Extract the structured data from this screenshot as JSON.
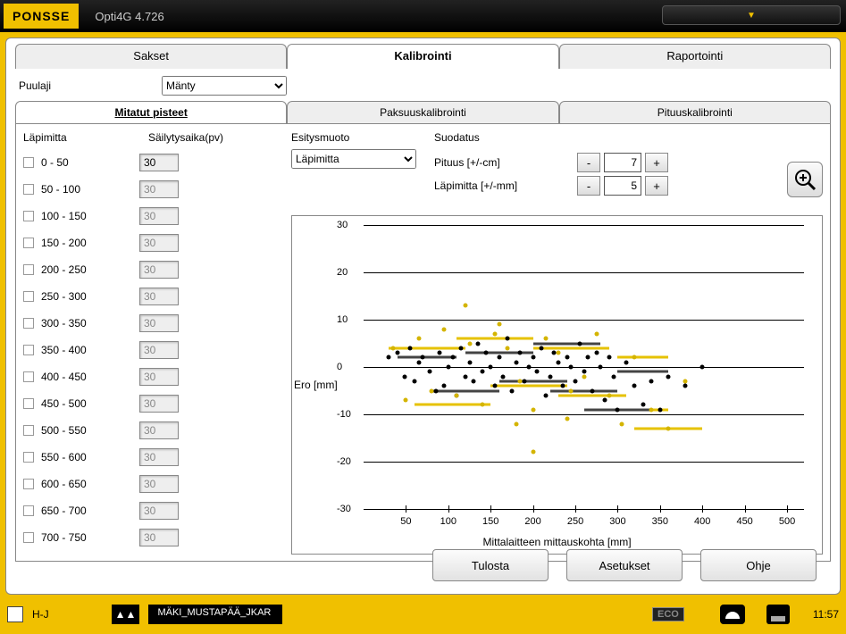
{
  "app": {
    "brand": "PONSSE",
    "title": "Opti4G 4.726"
  },
  "top_tabs": [
    "Sakset",
    "Kalibrointi",
    "Raportointi"
  ],
  "active_top_tab": 1,
  "species": {
    "label": "Puulaji",
    "value": "Mänty",
    "options": [
      "Mänty"
    ]
  },
  "sub_tabs": [
    "Mitatut pisteet",
    "Paksuuskalibrointi",
    "Pituuskalibrointi"
  ],
  "active_sub_tab": 0,
  "headers": {
    "diameter": "Läpimitta",
    "retention": "Säilytysaika(pv)"
  },
  "presentation": {
    "label": "Esitysmuoto",
    "value": "Läpimitta",
    "options": [
      "Läpimitta"
    ]
  },
  "filter": {
    "label": "Suodatus",
    "length": {
      "label": "Pituus [+/-cm]",
      "value": 7
    },
    "diameter": {
      "label": "Läpimitta [+/-mm]",
      "value": 5
    },
    "minus": "-",
    "plus": "+"
  },
  "size_classes": [
    {
      "label": "0   - 50",
      "ret": "30",
      "enabled": true
    },
    {
      "label": "50  - 100",
      "ret": "30",
      "enabled": false
    },
    {
      "label": "100 - 150",
      "ret": "30",
      "enabled": false
    },
    {
      "label": "150 - 200",
      "ret": "30",
      "enabled": false
    },
    {
      "label": "200 - 250",
      "ret": "30",
      "enabled": false
    },
    {
      "label": "250 - 300",
      "ret": "30",
      "enabled": false
    },
    {
      "label": "300 - 350",
      "ret": "30",
      "enabled": false
    },
    {
      "label": "350 - 400",
      "ret": "30",
      "enabled": false
    },
    {
      "label": "400 - 450",
      "ret": "30",
      "enabled": false
    },
    {
      "label": "450 - 500",
      "ret": "30",
      "enabled": false
    },
    {
      "label": "500 - 550",
      "ret": "30",
      "enabled": false
    },
    {
      "label": "550 - 600",
      "ret": "30",
      "enabled": false
    },
    {
      "label": "600 - 650",
      "ret": "30",
      "enabled": false
    },
    {
      "label": "650 - 700",
      "ret": "30",
      "enabled": false
    },
    {
      "label": "700 - 750",
      "ret": "30",
      "enabled": false
    }
  ],
  "buttons": {
    "print": "Tulosta",
    "settings": "Asetukset",
    "help": "Ohje"
  },
  "status": {
    "user": "H-J",
    "file": "MÄKI_MUSTAPÄÄ_JKAR",
    "eco": "ECO",
    "time": "11:57"
  },
  "chart_data": {
    "type": "scatter",
    "xlabel": "Mittalaitteen mittauskohta [mm]",
    "ylabel": "Ero [mm]",
    "xlim": [
      0,
      520
    ],
    "ylim": [
      -30,
      30
    ],
    "xticks": [
      50,
      100,
      150,
      200,
      250,
      300,
      350,
      400,
      450,
      500
    ],
    "yticks": [
      -30,
      -20,
      -10,
      0,
      10,
      20,
      30
    ],
    "series": [
      {
        "name": "black",
        "color": "#000",
        "x": [
          30,
          40,
          48,
          55,
          60,
          65,
          70,
          78,
          85,
          90,
          95,
          100,
          105,
          110,
          115,
          120,
          125,
          130,
          135,
          140,
          145,
          150,
          155,
          160,
          165,
          170,
          175,
          180,
          185,
          190,
          195,
          200,
          205,
          210,
          215,
          220,
          225,
          230,
          235,
          240,
          245,
          250,
          255,
          260,
          265,
          270,
          275,
          280,
          285,
          290,
          295,
          300,
          310,
          320,
          330,
          340,
          350,
          360,
          380,
          400
        ],
        "y": [
          2,
          3,
          -2,
          4,
          -3,
          1,
          2,
          -1,
          -5,
          3,
          -4,
          0,
          2,
          -6,
          4,
          -2,
          1,
          -3,
          5,
          -1,
          3,
          0,
          -4,
          2,
          -2,
          6,
          -5,
          1,
          3,
          -3,
          0,
          2,
          -1,
          4,
          -6,
          -2,
          3,
          1,
          -4,
          2,
          0,
          -3,
          5,
          -1,
          2,
          -5,
          3,
          0,
          -7,
          2,
          -2,
          -9,
          1,
          -4,
          -8,
          -3,
          -9,
          -2,
          -4,
          0
        ]
      },
      {
        "name": "yellow",
        "color": "#d4b400",
        "x": [
          35,
          50,
          65,
          80,
          95,
          110,
          125,
          140,
          155,
          170,
          185,
          200,
          215,
          230,
          245,
          260,
          275,
          290,
          305,
          320,
          340,
          360,
          380,
          120,
          180,
          160,
          240,
          200
        ],
        "y": [
          4,
          -7,
          6,
          -5,
          8,
          -6,
          5,
          -8,
          7,
          4,
          -3,
          -9,
          6,
          3,
          -5,
          -2,
          7,
          -6,
          -12,
          2,
          -9,
          -13,
          -3,
          13,
          -12,
          9,
          -11,
          -18
        ]
      }
    ],
    "bars_black": [
      {
        "x1": 40,
        "x2": 110,
        "y": 2
      },
      {
        "x1": 80,
        "x2": 160,
        "y": -5
      },
      {
        "x1": 120,
        "x2": 200,
        "y": 3
      },
      {
        "x1": 160,
        "x2": 240,
        "y": -3
      },
      {
        "x1": 200,
        "x2": 280,
        "y": 5
      },
      {
        "x1": 220,
        "x2": 300,
        "y": -5
      },
      {
        "x1": 260,
        "x2": 340,
        "y": -9
      },
      {
        "x1": 300,
        "x2": 360,
        "y": -1
      }
    ],
    "bars_yellow": [
      {
        "x1": 30,
        "x2": 120,
        "y": 4
      },
      {
        "x1": 60,
        "x2": 150,
        "y": -8
      },
      {
        "x1": 110,
        "x2": 200,
        "y": 6
      },
      {
        "x1": 150,
        "x2": 240,
        "y": -4
      },
      {
        "x1": 200,
        "x2": 290,
        "y": 4
      },
      {
        "x1": 230,
        "x2": 310,
        "y": -6
      },
      {
        "x1": 270,
        "x2": 360,
        "y": -9
      },
      {
        "x1": 320,
        "x2": 400,
        "y": -13
      },
      {
        "x1": 300,
        "x2": 360,
        "y": 2
      }
    ]
  }
}
